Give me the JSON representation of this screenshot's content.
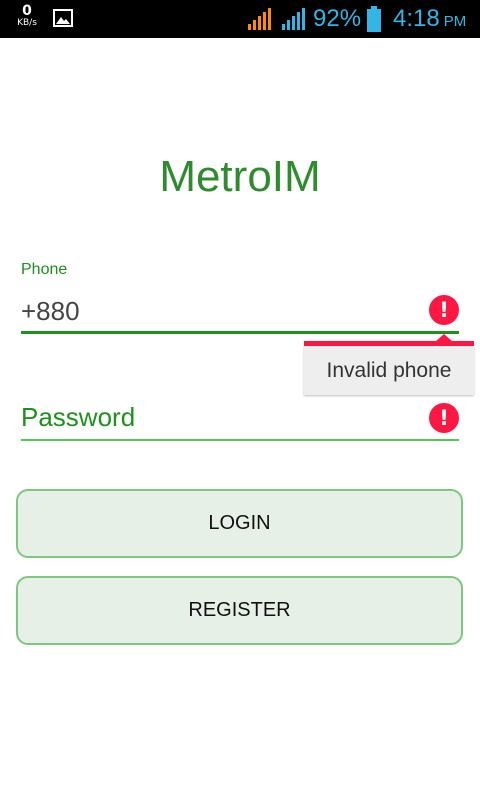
{
  "status_bar": {
    "net_speed_value": "0",
    "net_speed_unit": "KB/s",
    "battery_percent": "92%",
    "time": "4:18",
    "ampm": "PM",
    "icons": [
      "image-notification-icon",
      "signal-icon",
      "signal-icon",
      "battery-icon"
    ],
    "colors": {
      "signal_primary": "#ff8c00",
      "signal_secondary": "#33b5e5",
      "text": "#33b5e5"
    }
  },
  "app": {
    "title": "MetroIM"
  },
  "form": {
    "phone": {
      "label": "Phone",
      "value": "+880",
      "error_tooltip": "Invalid phone"
    },
    "password": {
      "placeholder": "Password"
    },
    "buttons": {
      "login": "LOGIN",
      "register": "REGISTER"
    }
  },
  "colors": {
    "accent": "#1f8f1f",
    "error": "#ff1744",
    "button_bg": "#e6f0e6"
  }
}
